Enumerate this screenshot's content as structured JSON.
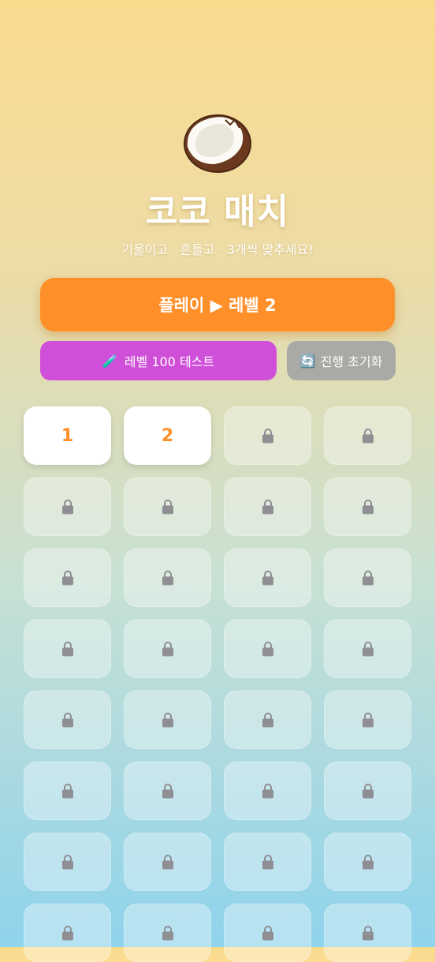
{
  "app": {
    "title": "코코 매치",
    "subtitle": "기울이고 · 흔들고 · 3개씩 맞추세요!",
    "logo_icon": "coconut-icon"
  },
  "buttons": {
    "play_label": "플레이 ▶ 레벨 2",
    "test_icon": "🧪",
    "test_label": "레벨 100 테스트",
    "reset_icon": "🔄",
    "reset_label": "진행 초기화"
  },
  "levels": [
    {
      "label": "1",
      "locked": false
    },
    {
      "label": "2",
      "locked": false
    },
    {
      "label": "",
      "locked": true
    },
    {
      "label": "",
      "locked": true
    },
    {
      "label": "",
      "locked": true
    },
    {
      "label": "",
      "locked": true
    },
    {
      "label": "",
      "locked": true
    },
    {
      "label": "",
      "locked": true
    },
    {
      "label": "",
      "locked": true
    },
    {
      "label": "",
      "locked": true
    },
    {
      "label": "",
      "locked": true
    },
    {
      "label": "",
      "locked": true
    },
    {
      "label": "",
      "locked": true
    },
    {
      "label": "",
      "locked": true
    },
    {
      "label": "",
      "locked": true
    },
    {
      "label": "",
      "locked": true
    },
    {
      "label": "",
      "locked": true
    },
    {
      "label": "",
      "locked": true
    },
    {
      "label": "",
      "locked": true
    },
    {
      "label": "",
      "locked": true
    },
    {
      "label": "",
      "locked": true
    },
    {
      "label": "",
      "locked": true
    },
    {
      "label": "",
      "locked": true
    },
    {
      "label": "",
      "locked": true
    },
    {
      "label": "",
      "locked": true
    },
    {
      "label": "",
      "locked": true
    },
    {
      "label": "",
      "locked": true
    },
    {
      "label": "",
      "locked": true
    },
    {
      "label": "",
      "locked": true
    },
    {
      "label": "",
      "locked": true
    },
    {
      "label": "",
      "locked": true
    },
    {
      "label": "",
      "locked": true
    }
  ],
  "colors": {
    "accent": "#ff8f28",
    "test_button": "#cf4fd9",
    "reset_button": "#a9a9a6",
    "lock": "#8e8e93"
  }
}
